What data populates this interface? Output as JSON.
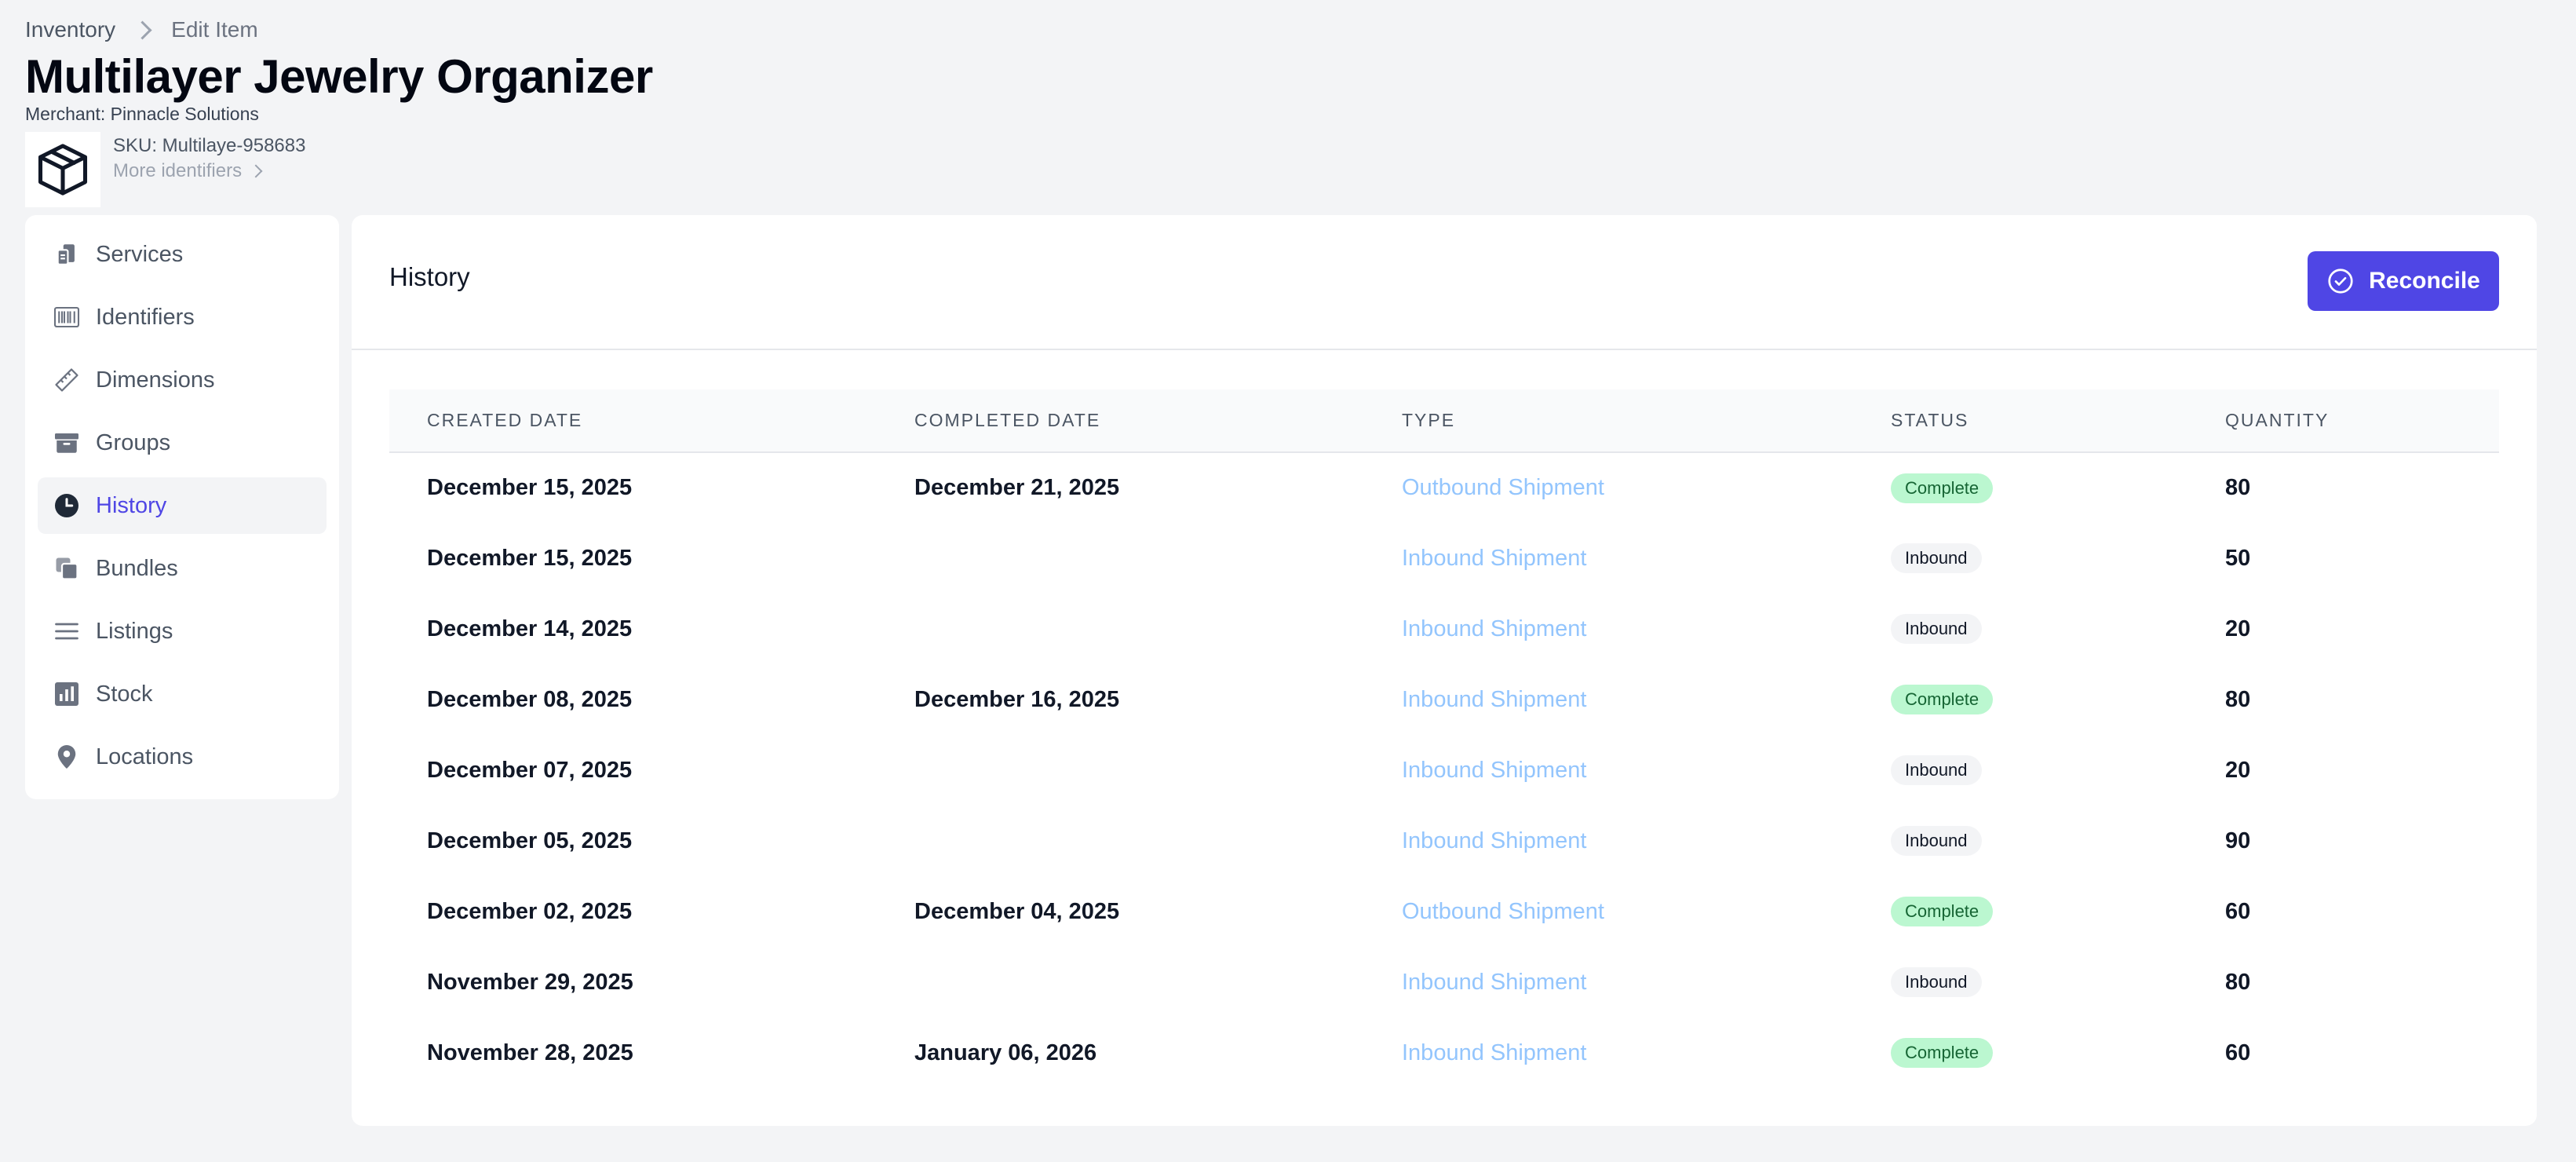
{
  "breadcrumb": {
    "root": "Inventory",
    "current": "Edit Item"
  },
  "product": {
    "title": "Multilayer Jewelry Organizer",
    "merchant": "Merchant: Pinnacle Solutions",
    "sku": "SKU: Multilaye-958683",
    "more_identifiers": "More identifiers",
    "thumbnail_icon": "cube-icon"
  },
  "sidebar": {
    "items": [
      {
        "label": "Services",
        "icon": "services-icon",
        "active": false
      },
      {
        "label": "Identifiers",
        "icon": "barcode-icon",
        "active": false
      },
      {
        "label": "Dimensions",
        "icon": "ruler-icon",
        "active": false
      },
      {
        "label": "Groups",
        "icon": "archive-box-icon",
        "active": false
      },
      {
        "label": "History",
        "icon": "clock-icon",
        "active": true
      },
      {
        "label": "Bundles",
        "icon": "stacked-squares-icon",
        "active": false
      },
      {
        "label": "Listings",
        "icon": "list-icon",
        "active": false
      },
      {
        "label": "Stock",
        "icon": "bar-chart-icon",
        "active": false
      },
      {
        "label": "Locations",
        "icon": "map-pin-icon",
        "active": false
      }
    ]
  },
  "panel": {
    "title": "History",
    "reconcile_label": "Reconcile"
  },
  "table": {
    "columns": [
      "CREATED DATE",
      "COMPLETED DATE",
      "TYPE",
      "STATUS",
      "QUANTITY"
    ],
    "rows": [
      {
        "created": "December 15, 2025",
        "completed": "December 21, 2025",
        "type": "Outbound Shipment",
        "status": "Complete",
        "quantity": "80"
      },
      {
        "created": "December 15, 2025",
        "completed": "",
        "type": "Inbound Shipment",
        "status": "Inbound",
        "quantity": "50"
      },
      {
        "created": "December 14, 2025",
        "completed": "",
        "type": "Inbound Shipment",
        "status": "Inbound",
        "quantity": "20"
      },
      {
        "created": "December 08, 2025",
        "completed": "December 16, 2025",
        "type": "Inbound Shipment",
        "status": "Complete",
        "quantity": "80"
      },
      {
        "created": "December 07, 2025",
        "completed": "",
        "type": "Inbound Shipment",
        "status": "Inbound",
        "quantity": "20"
      },
      {
        "created": "December 05, 2025",
        "completed": "",
        "type": "Inbound Shipment",
        "status": "Inbound",
        "quantity": "90"
      },
      {
        "created": "December 02, 2025",
        "completed": "December 04, 2025",
        "type": "Outbound Shipment",
        "status": "Complete",
        "quantity": "60"
      },
      {
        "created": "November 29, 2025",
        "completed": "",
        "type": "Inbound Shipment",
        "status": "Inbound",
        "quantity": "80"
      },
      {
        "created": "November 28, 2025",
        "completed": "January 06, 2026",
        "type": "Inbound Shipment",
        "status": "Complete",
        "quantity": "60"
      }
    ]
  },
  "colors": {
    "accent": "#4f46e5",
    "link": "#93c5fd",
    "complete_bg": "#bbf7d0",
    "complete_text": "#166534",
    "inbound_bg": "#f3f4f6",
    "page_bg": "#f3f4f6",
    "icon_gray": "#6b7280"
  }
}
